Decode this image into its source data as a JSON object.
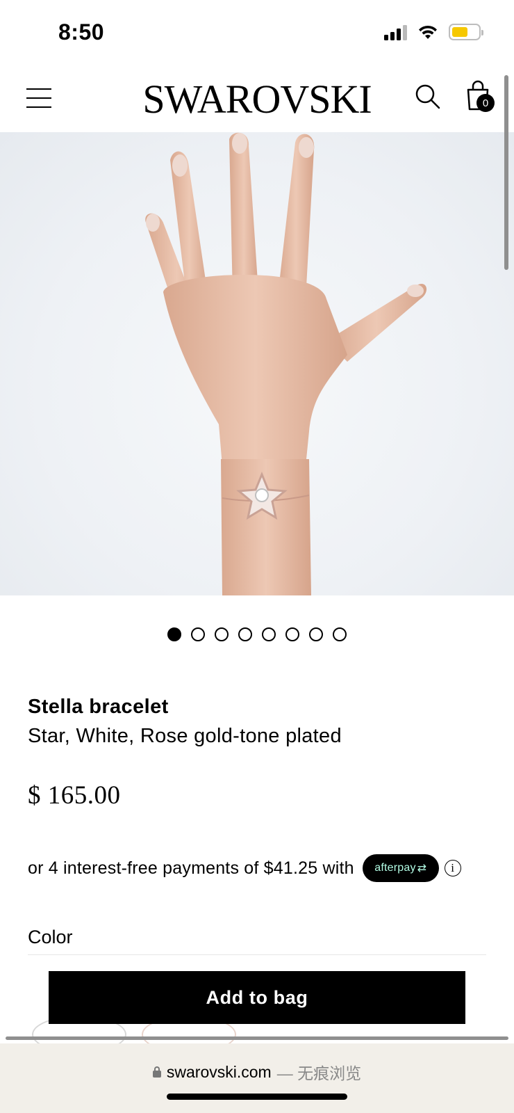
{
  "status_bar": {
    "time": "8:50"
  },
  "header": {
    "logo": "SWAROVSKI",
    "menu_icon": "hamburger-menu-icon",
    "search_icon": "search-icon",
    "bag_icon": "shopping-bag-icon",
    "bag_count": "0"
  },
  "carousel": {
    "total_slides": 8,
    "active_index": 0
  },
  "product": {
    "name": "Stella bracelet",
    "description": "Star, White, Rose gold-tone plated",
    "price": "$ 165.00"
  },
  "installments": {
    "text": "or 4 interest-free payments of $41.25 with",
    "provider": "afterpay",
    "info_symbol": "i"
  },
  "color": {
    "label": "Color"
  },
  "cta": {
    "add_to_bag": "Add to bag"
  },
  "browser": {
    "domain": "swarovski.com",
    "suffix": "— 无痕浏览"
  },
  "colors": {
    "afterpay_text": "#b2fce4",
    "battery": "#f6c800"
  }
}
